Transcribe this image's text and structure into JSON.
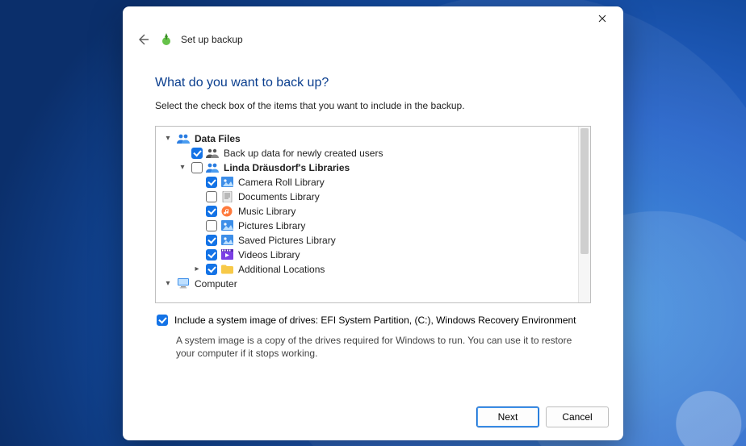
{
  "header": {
    "title": "Set up backup"
  },
  "page": {
    "heading": "What do you want to back up?",
    "instruction": "Select the check box of the items that you want to include in the backup."
  },
  "tree": {
    "dataFiles": {
      "label": "Data Files",
      "expanded": true,
      "children": [
        {
          "label": "Back up data for newly created users",
          "checked": true
        },
        {
          "label": "Linda Dräusdorf's Libraries",
          "checked": false,
          "expanded": true,
          "children": [
            {
              "label": "Camera Roll Library",
              "checked": true
            },
            {
              "label": "Documents Library",
              "checked": false
            },
            {
              "label": "Music Library",
              "checked": true
            },
            {
              "label": "Pictures Library",
              "checked": false
            },
            {
              "label": "Saved Pictures Library",
              "checked": true
            },
            {
              "label": "Videos Library",
              "checked": true
            },
            {
              "label": "Additional Locations",
              "checked": true,
              "expandable": true
            }
          ]
        }
      ]
    },
    "computer": {
      "label": "Computer",
      "expanded": true
    }
  },
  "systemImage": {
    "checked": true,
    "label": "Include a system image of drives: EFI System Partition, (C:), Windows Recovery Environment",
    "description": "A system image is a copy of the drives required for Windows to run. You can use it to restore your computer if it stops working."
  },
  "footer": {
    "next": "Next",
    "cancel": "Cancel"
  }
}
